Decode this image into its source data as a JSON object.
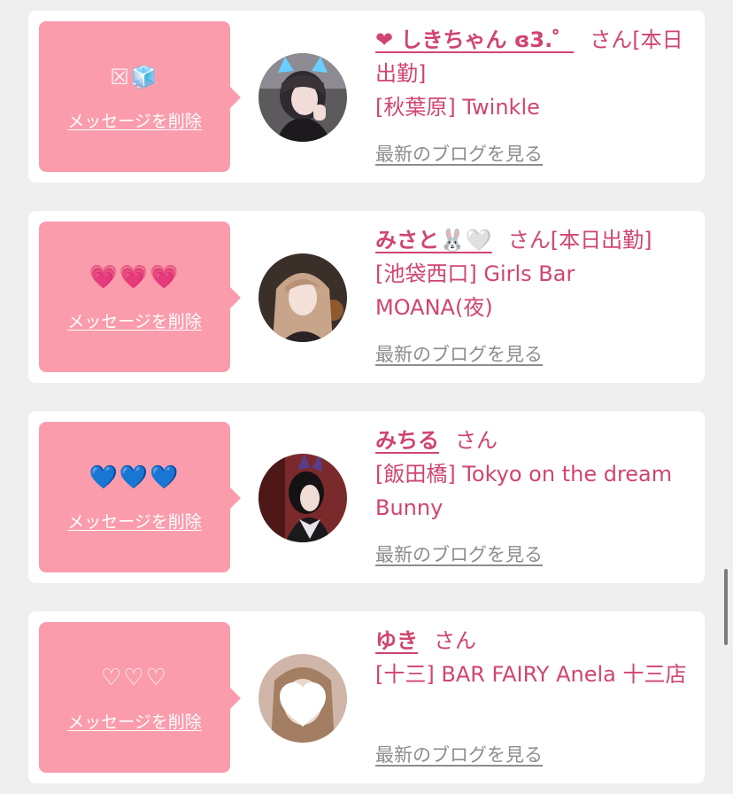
{
  "cards": [
    {
      "message": "☒🧊",
      "delete_label": "メッセージを削除",
      "name": "❤︎ しきちゃん ɞ3.゜",
      "honorific": "さん",
      "status": "[本日出勤]",
      "shop": "[秋葉原] Twinkle",
      "blog_label": "最新のブログを見る",
      "avatar_icon": "portrait-photo"
    },
    {
      "message": "💗💗💗",
      "delete_label": "メッセージを削除",
      "name": "みさと🐰🤍",
      "honorific": "さん",
      "status": "[本日出勤]",
      "shop": "[池袋西口] Girls Bar MOANA(夜)",
      "blog_label": "最新のブログを見る",
      "avatar_icon": "portrait-photo"
    },
    {
      "message": "💙💙💙",
      "delete_label": "メッセージを削除",
      "name": "みちる",
      "honorific": "さん",
      "status": "",
      "shop": "[飯田橋] Tokyo on the dream Bunny",
      "blog_label": "最新のブログを見る",
      "avatar_icon": "portrait-photo"
    },
    {
      "message": "♡♡♡",
      "delete_label": "メッセージを削除",
      "name": "ゆき",
      "honorific": "さん",
      "status": "",
      "shop": "[十三] BAR FAIRY Anela 十三店",
      "blog_label": "最新のブログを見る",
      "avatar_icon": "heart-covered-photo"
    }
  ],
  "colors": {
    "background": "#efefef",
    "bubble": "#fa9cac",
    "accent": "#d0456f",
    "link_gray": "#8d8d8d"
  }
}
